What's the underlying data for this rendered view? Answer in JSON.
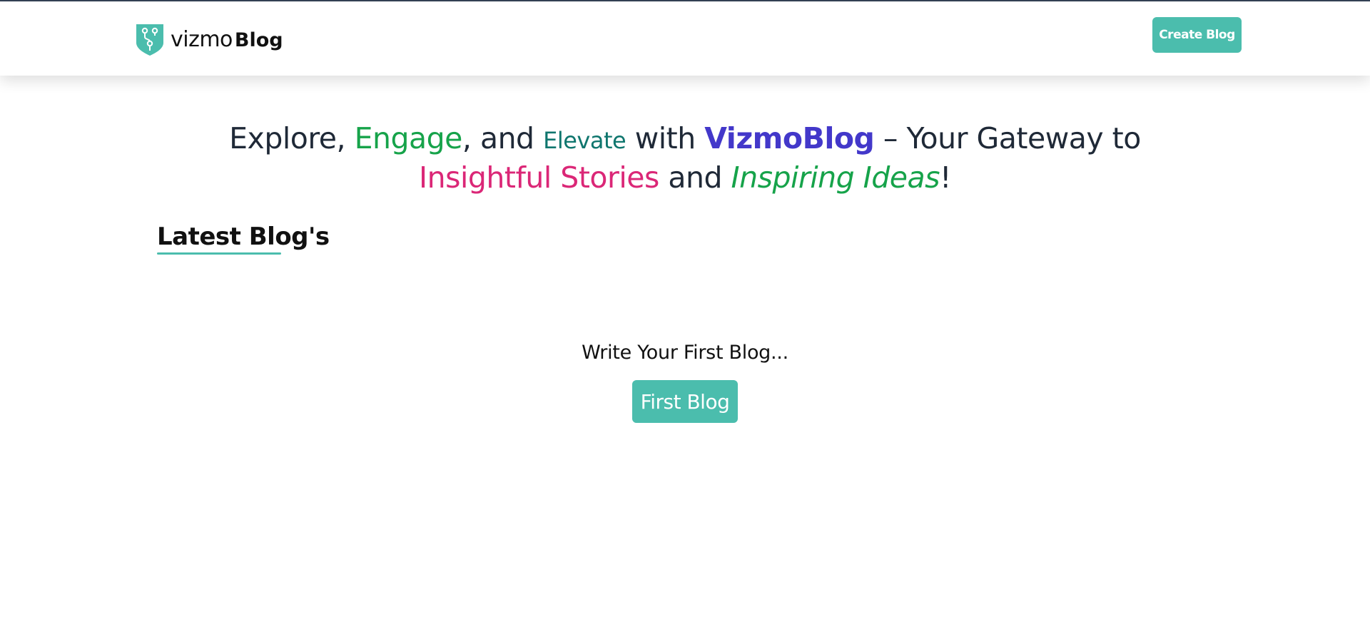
{
  "header": {
    "logo": {
      "icon": "git-branch-shield-icon",
      "text_vizmo": "vizmo",
      "text_blog": "Blog",
      "color": "#4bbdad"
    },
    "create_button_label": "Create Blog"
  },
  "hero": {
    "parts": {
      "p1": "Explore, ",
      "engage": "Engage",
      "p2": ", and ",
      "elevate": "Elevate",
      "p3": " with ",
      "vizmoblog": "VizmoBlog",
      "p4": " – Your Gateway to ",
      "insightful": "Insightful Stories",
      "p5": " and ",
      "inspiring": "Inspiring Ideas",
      "p6": "!"
    }
  },
  "latest": {
    "title": "Latest Blog's"
  },
  "empty_state": {
    "message": "Write Your First Blog...",
    "button_label": "First Blog"
  },
  "colors": {
    "accent": "#4bbdad",
    "engage": "#16a34a",
    "elevate": "#0f766e",
    "vizmoblog": "#4338ca",
    "insightful": "#db2777",
    "text": "#1f2937"
  }
}
